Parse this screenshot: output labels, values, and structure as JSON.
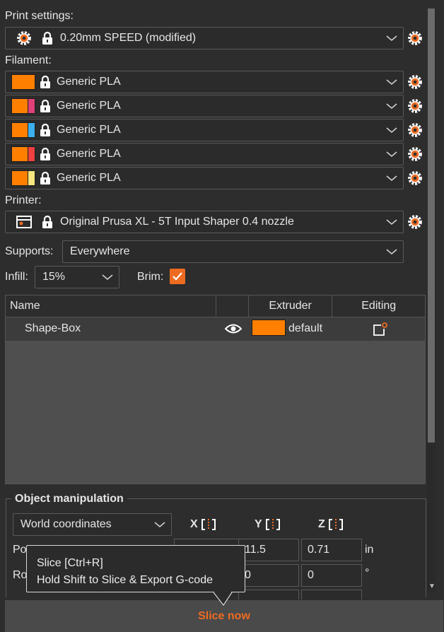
{
  "print_settings": {
    "label": "Print settings:",
    "value": "0.20mm SPEED (modified)"
  },
  "filament": {
    "label": "Filament:",
    "items": [
      {
        "value": "Generic PLA",
        "colors": [
          "#ff8000"
        ]
      },
      {
        "value": "Generic PLA",
        "colors": [
          "#ff8000",
          "#e0407a"
        ]
      },
      {
        "value": "Generic PLA",
        "colors": [
          "#ff8000",
          "#3ab0f0"
        ]
      },
      {
        "value": "Generic PLA",
        "colors": [
          "#ff8000",
          "#f04040"
        ]
      },
      {
        "value": "Generic PLA",
        "colors": [
          "#ff8000",
          "#f5e680"
        ]
      }
    ]
  },
  "printer": {
    "label": "Printer:",
    "value": "Original Prusa XL - 5T Input Shaper 0.4 nozzle"
  },
  "supports": {
    "label": "Supports:",
    "value": "Everywhere"
  },
  "infill": {
    "label": "Infill:",
    "value": "15%"
  },
  "brim": {
    "label": "Brim:",
    "checked": true
  },
  "object_list": {
    "columns": [
      "Name",
      "",
      "Extruder",
      "Editing"
    ],
    "rows": [
      {
        "name": "Shape-Box",
        "extruder": "default",
        "extruder_color": "#ff8000"
      }
    ]
  },
  "object_manipulation": {
    "title": "Object manipulation",
    "coordinates": "World coordinates",
    "axes": [
      "X",
      "Y",
      "Z"
    ],
    "position": {
      "label": "Po",
      "y": "11.5",
      "z": "0.71",
      "unit": "in"
    },
    "rotation": {
      "label": "Ro",
      "y": "0",
      "z": "0",
      "unit": "°"
    }
  },
  "tooltip": {
    "line1": "Slice [Ctrl+R]",
    "line2": "Hold Shift to Slice & Export G-code"
  },
  "slice_button": {
    "label": "Slice now"
  },
  "colors": {
    "accent": "#ed6b21",
    "gear": "#ed6b21"
  },
  "icons": {
    "settings": "gear-icon",
    "lock": "lock-icon",
    "dropdown": "chevron-down-icon",
    "visibility": "eye-icon",
    "edit": "edit-icon"
  }
}
